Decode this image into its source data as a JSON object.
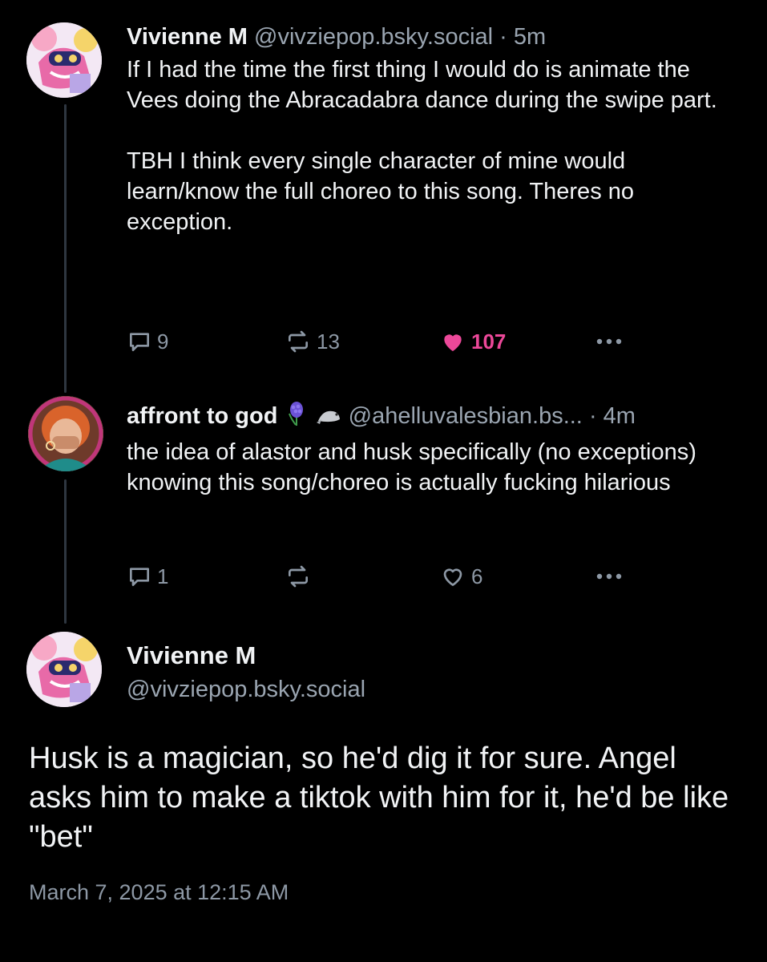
{
  "posts": [
    {
      "author": "Vivienne M",
      "handle": "@vivziepop.bsky.social",
      "sep": "·",
      "time": "5m",
      "paragraphs": [
        "If I had the time the first thing I would do is animate the Vees doing the Abracadabra dance during the swipe part.",
        "TBH I think every single character of mine would learn/know the full choreo to this song. Theres no exception."
      ],
      "reply_count": "9",
      "repost_count": "13",
      "like_count": "107",
      "liked": true,
      "avatar_icon": "cartoon-avatar-icon"
    },
    {
      "author": "affront to god",
      "author_emoji": [
        "hyacinth-emoji",
        "seal-emoji"
      ],
      "handle": "@ahelluvalesbian.bs...",
      "sep": "·",
      "time": "4m",
      "paragraphs": [
        "the idea of alastor and husk specifically (no exceptions) knowing this song/choreo is actually fucking hilarious"
      ],
      "reply_count": "1",
      "repost_count": "",
      "like_count": "6",
      "liked": false,
      "avatar_icon": "photo-avatar-icon"
    }
  ],
  "focus": {
    "author": "Vivienne M",
    "handle": "@vivziepop.bsky.social",
    "text": "Husk is a magician, so he'd dig it for sure. Angel asks him to make a tiktok with him for it, he'd be like \"bet\"",
    "date": "March 7, 2025 at 12:15 AM"
  },
  "colors": {
    "background": "#000000",
    "text": "#f1f3f5",
    "muted": "#9aa5b1",
    "like_active": "#ec4899",
    "thread_line": "#2e3640"
  }
}
